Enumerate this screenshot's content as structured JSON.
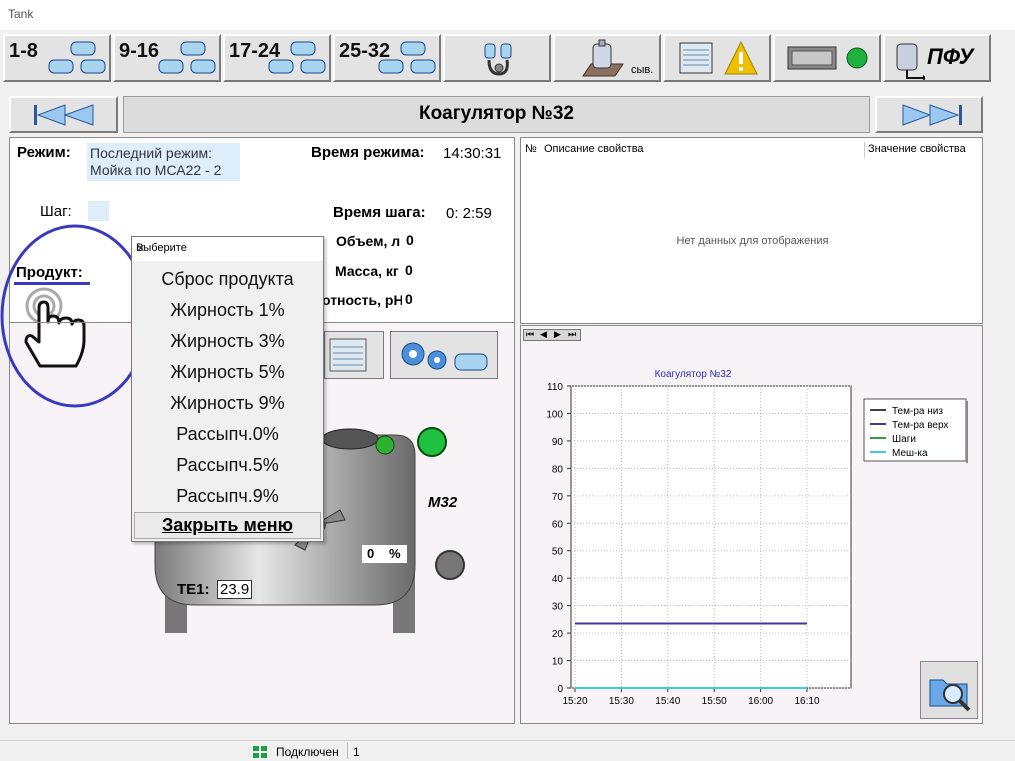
{
  "window": {
    "title": "Tank"
  },
  "toolbar": {
    "groups": [
      "1-8",
      "9-16",
      "17-24",
      "25-32"
    ],
    "cheese_label": "сыв.",
    "pfu_label": "ПФУ"
  },
  "nav": {
    "title": "Коагулятор №32"
  },
  "mode": {
    "mode_label": "Режим:",
    "mode_value_line1": "Последний режим:",
    "mode_value_line2": "Мойка по МСА22 - 2",
    "mode_time_label": "Время режима:",
    "mode_time_value": "14:30:31",
    "step_label": "Шаг:",
    "step_time_label": "Время шага:",
    "step_time_value": "0: 2:59",
    "product_label": "Продукт:",
    "volume_label": "Объем, л",
    "volume_value": "0",
    "mass_label": "Масса, кг",
    "mass_value": "0",
    "ph_label": "отность, pH",
    "ph_value": "0"
  },
  "tank": {
    "name": "М32",
    "percent_value": "0",
    "percent_unit": "%",
    "te1_label": "ТЕ1:",
    "te1_value": "23.9"
  },
  "popup": {
    "title": "Выберите",
    "items": [
      "Сброс продукта",
      "Жирность 1%",
      "Жирность 3%",
      "Жирность 5%",
      "Жирность 9%",
      "Рассыпч.0%",
      "Рассыпч.5%",
      "Рассыпч.9%"
    ],
    "close_menu": "Закрыть меню"
  },
  "properties": {
    "col_no": "№",
    "col_desc": "Описание свойства",
    "col_value": "Значение свойства",
    "empty": "Нет данных для отображения"
  },
  "status": {
    "connection": "Подключен",
    "count": "1"
  },
  "colors": {
    "t_low": "#404040",
    "t_high": "#3a3aa0",
    "steps": "#3a9a3a",
    "mixer": "#3ad0d0",
    "highlight": "#3a3ac0"
  },
  "chart_data": {
    "type": "line",
    "title": "Коагулятор №32",
    "x": [
      "15:20",
      "15:30",
      "15:40",
      "15:50",
      "16:00",
      "16:10"
    ],
    "ylim": [
      0,
      110
    ],
    "yticks": [
      0,
      10,
      20,
      30,
      40,
      50,
      60,
      70,
      80,
      90,
      100,
      110
    ],
    "grid": true,
    "legend_position": "right",
    "series": [
      {
        "name": "Тем-ра низ",
        "color": "#404040",
        "values": [
          23.5,
          23.5,
          23.5,
          23.5,
          23.5,
          23.5
        ]
      },
      {
        "name": "Тем-ра верх",
        "color": "#3a3aa0",
        "values": [
          23.5,
          23.5,
          23.5,
          23.5,
          23.5,
          23.5
        ]
      },
      {
        "name": "Шаги",
        "color": "#3a9a3a",
        "values": [
          0,
          0,
          0,
          0,
          0,
          0
        ]
      },
      {
        "name": "Меш-ка",
        "color": "#3ad0d0",
        "values": [
          0,
          0,
          0,
          0,
          0,
          0
        ]
      }
    ]
  }
}
